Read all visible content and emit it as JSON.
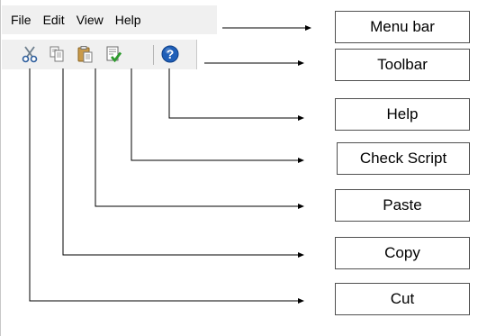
{
  "menu": {
    "file": "File",
    "edit": "Edit",
    "view": "View",
    "help": "Help"
  },
  "toolbar_icons": [
    "cut-icon",
    "copy-icon",
    "paste-icon",
    "check-script-icon",
    "help-icon"
  ],
  "labels": {
    "menu_bar": "Menu bar",
    "toolbar": "Toolbar",
    "help": "Help",
    "check_script": "Check Script",
    "paste": "Paste",
    "copy": "Copy",
    "cut": "Cut"
  },
  "colors": {
    "chrome": "#f0f0f0",
    "arrow": "#000000",
    "box_border": "#505050",
    "help_blue": "#1f5fb8",
    "check_green": "#2e9b2e"
  }
}
